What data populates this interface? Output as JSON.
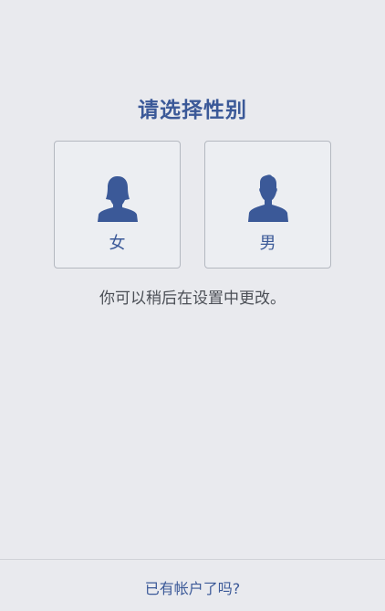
{
  "title": "请选择性别",
  "options": [
    {
      "label": "女",
      "icon": "female-avatar-icon"
    },
    {
      "label": "男",
      "icon": "male-avatar-icon"
    }
  ],
  "hint": "你可以稍后在设置中更改。",
  "footer": {
    "link_label": "已有帐户了吗?"
  },
  "colors": {
    "accent": "#3b5998",
    "background": "#e9eaee"
  }
}
